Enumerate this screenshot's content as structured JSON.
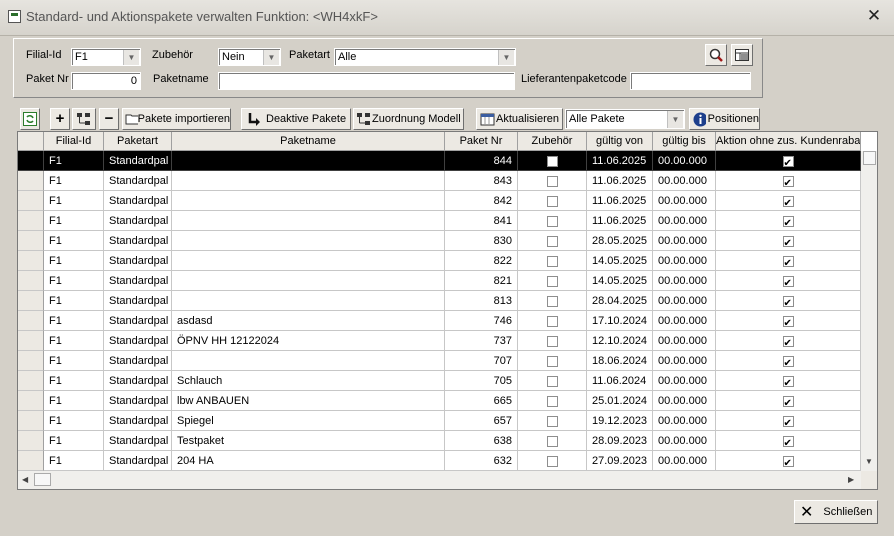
{
  "window": {
    "title": "Standard- und Aktionspakete verwalten   Funktion: <WH4xkF>",
    "close_glyph": "✕"
  },
  "filter": {
    "filial_label": "Filial-Id",
    "filial_value": "F1",
    "zubehoer_label": "Zubehör",
    "zubehoer_value": "Nein",
    "paketart_label": "Paketart",
    "paketart_value": "Alle",
    "paketnr_label": "Paket Nr",
    "paketnr_value": "0",
    "paketname_label": "Paketname",
    "paketname_value": "",
    "lieferant_label": "Lieferantenpaketcode",
    "lieferant_value": ""
  },
  "toolbar": {
    "import_label": "Pakete importieren",
    "deactive_label": "Deaktive Pakete",
    "zuordnung_label": "Zuordnung Modell",
    "aktualisieren_label": "Aktualisieren",
    "filter_value": "Alle Pakete",
    "positionen_label": "Positionen"
  },
  "table": {
    "columns": [
      "Filial-Id",
      "Paketart",
      "Paketname",
      "Paket Nr",
      "Zubehör",
      "gültig von",
      "gültig bis",
      "Aktion ohne zus. Kundenrabatt"
    ],
    "rows": [
      {
        "filial": "F1",
        "art": "Standardpal",
        "name": "",
        "nr": "844",
        "zub": false,
        "von": "11.06.2025",
        "bis": "00.00.000",
        "aktion": true
      },
      {
        "filial": "F1",
        "art": "Standardpal",
        "name": "",
        "nr": "843",
        "zub": false,
        "von": "11.06.2025",
        "bis": "00.00.000",
        "aktion": true
      },
      {
        "filial": "F1",
        "art": "Standardpal",
        "name": "",
        "nr": "842",
        "zub": false,
        "von": "11.06.2025",
        "bis": "00.00.000",
        "aktion": true
      },
      {
        "filial": "F1",
        "art": "Standardpal",
        "name": "",
        "nr": "841",
        "zub": false,
        "von": "11.06.2025",
        "bis": "00.00.000",
        "aktion": true
      },
      {
        "filial": "F1",
        "art": "Standardpal",
        "name": "",
        "nr": "830",
        "zub": false,
        "von": "28.05.2025",
        "bis": "00.00.000",
        "aktion": true
      },
      {
        "filial": "F1",
        "art": "Standardpal",
        "name": "",
        "nr": "822",
        "zub": false,
        "von": "14.05.2025",
        "bis": "00.00.000",
        "aktion": true
      },
      {
        "filial": "F1",
        "art": "Standardpal",
        "name": "",
        "nr": "821",
        "zub": false,
        "von": "14.05.2025",
        "bis": "00.00.000",
        "aktion": true
      },
      {
        "filial": "F1",
        "art": "Standardpal",
        "name": "",
        "nr": "813",
        "zub": false,
        "von": "28.04.2025",
        "bis": "00.00.000",
        "aktion": true
      },
      {
        "filial": "F1",
        "art": "Standardpal",
        "name": "asdasd",
        "nr": "746",
        "zub": false,
        "von": "17.10.2024",
        "bis": "00.00.000",
        "aktion": true
      },
      {
        "filial": "F1",
        "art": "Standardpal",
        "name": "ÖPNV HH 12122024",
        "nr": "737",
        "zub": false,
        "von": "12.10.2024",
        "bis": "00.00.000",
        "aktion": true
      },
      {
        "filial": "F1",
        "art": "Standardpal",
        "name": "",
        "nr": "707",
        "zub": false,
        "von": "18.06.2024",
        "bis": "00.00.000",
        "aktion": true
      },
      {
        "filial": "F1",
        "art": "Standardpal",
        "name": "Schlauch",
        "nr": "705",
        "zub": false,
        "von": "11.06.2024",
        "bis": "00.00.000",
        "aktion": true
      },
      {
        "filial": "F1",
        "art": "Standardpal",
        "name": "lbw ANBAUEN",
        "nr": "665",
        "zub": false,
        "von": "25.01.2024",
        "bis": "00.00.000",
        "aktion": true
      },
      {
        "filial": "F1",
        "art": "Standardpal",
        "name": "Spiegel",
        "nr": "657",
        "zub": false,
        "von": "19.12.2023",
        "bis": "00.00.000",
        "aktion": true
      },
      {
        "filial": "F1",
        "art": "Standardpal",
        "name": "Testpaket",
        "nr": "638",
        "zub": false,
        "von": "28.09.2023",
        "bis": "00.00.000",
        "aktion": true
      },
      {
        "filial": "F1",
        "art": "Standardpal",
        "name": "204 HA",
        "nr": "632",
        "zub": false,
        "von": "27.09.2023",
        "bis": "00.00.000",
        "aktion": true
      }
    ]
  },
  "footer": {
    "close_label": "Schließen"
  }
}
